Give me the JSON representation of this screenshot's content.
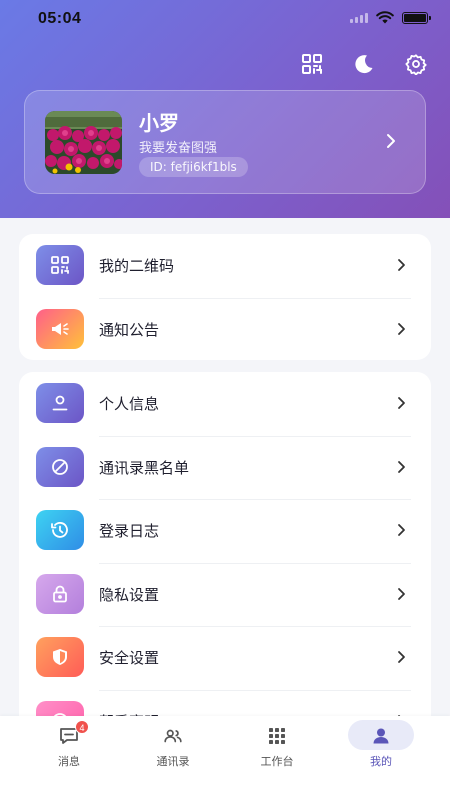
{
  "status_bar": {
    "time": "05:04"
  },
  "header": {
    "actions": [
      {
        "name": "qr-code-icon"
      },
      {
        "name": "dark-mode-icon"
      },
      {
        "name": "settings-icon"
      }
    ]
  },
  "profile": {
    "name": "小罗",
    "motto": "我要发奋图强",
    "id_text": "ID: fefji6kf1bls"
  },
  "menu_group_1": [
    {
      "label": "我的二维码",
      "icon": "qr-code-icon",
      "gradient": [
        "#7e8fe8",
        "#6c55c6"
      ]
    },
    {
      "label": "通知公告",
      "icon": "megaphone-icon",
      "gradient": [
        "#ff5f8a",
        "#ffc13a"
      ]
    }
  ],
  "menu_group_2": [
    {
      "label": "个人信息",
      "icon": "person-icon",
      "gradient": [
        "#7e8fe8",
        "#6c55c6"
      ]
    },
    {
      "label": "通讯录黑名单",
      "icon": "block-icon",
      "gradient": [
        "#7e8fe8",
        "#6c55c6"
      ]
    },
    {
      "label": "登录日志",
      "icon": "history-icon",
      "gradient": [
        "#3ed3f2",
        "#2f8de6"
      ]
    },
    {
      "label": "隐私设置",
      "icon": "lock-icon",
      "gradient": [
        "#d6a8ec",
        "#b37fdc"
      ]
    },
    {
      "label": "安全设置",
      "icon": "shield-icon",
      "gradient": [
        "#ffa15e",
        "#ff5c57"
      ]
    },
    {
      "label": "帮手察明",
      "icon": "help-icon",
      "gradient": [
        "#ff8fc8",
        "#ff5fa9"
      ]
    }
  ],
  "tabbar": {
    "tabs": [
      {
        "label": "消息",
        "icon": "message-icon",
        "badge": "4"
      },
      {
        "label": "通讯录",
        "icon": "contacts-icon"
      },
      {
        "label": "工作台",
        "icon": "workbench-icon"
      },
      {
        "label": "我的",
        "icon": "profile-icon",
        "active": true
      }
    ]
  },
  "colors": {
    "header_gradient": [
      "#6a7ae6",
      "#8450b8"
    ],
    "active_tab": "#5b56b8",
    "badge": "#f0524d"
  }
}
